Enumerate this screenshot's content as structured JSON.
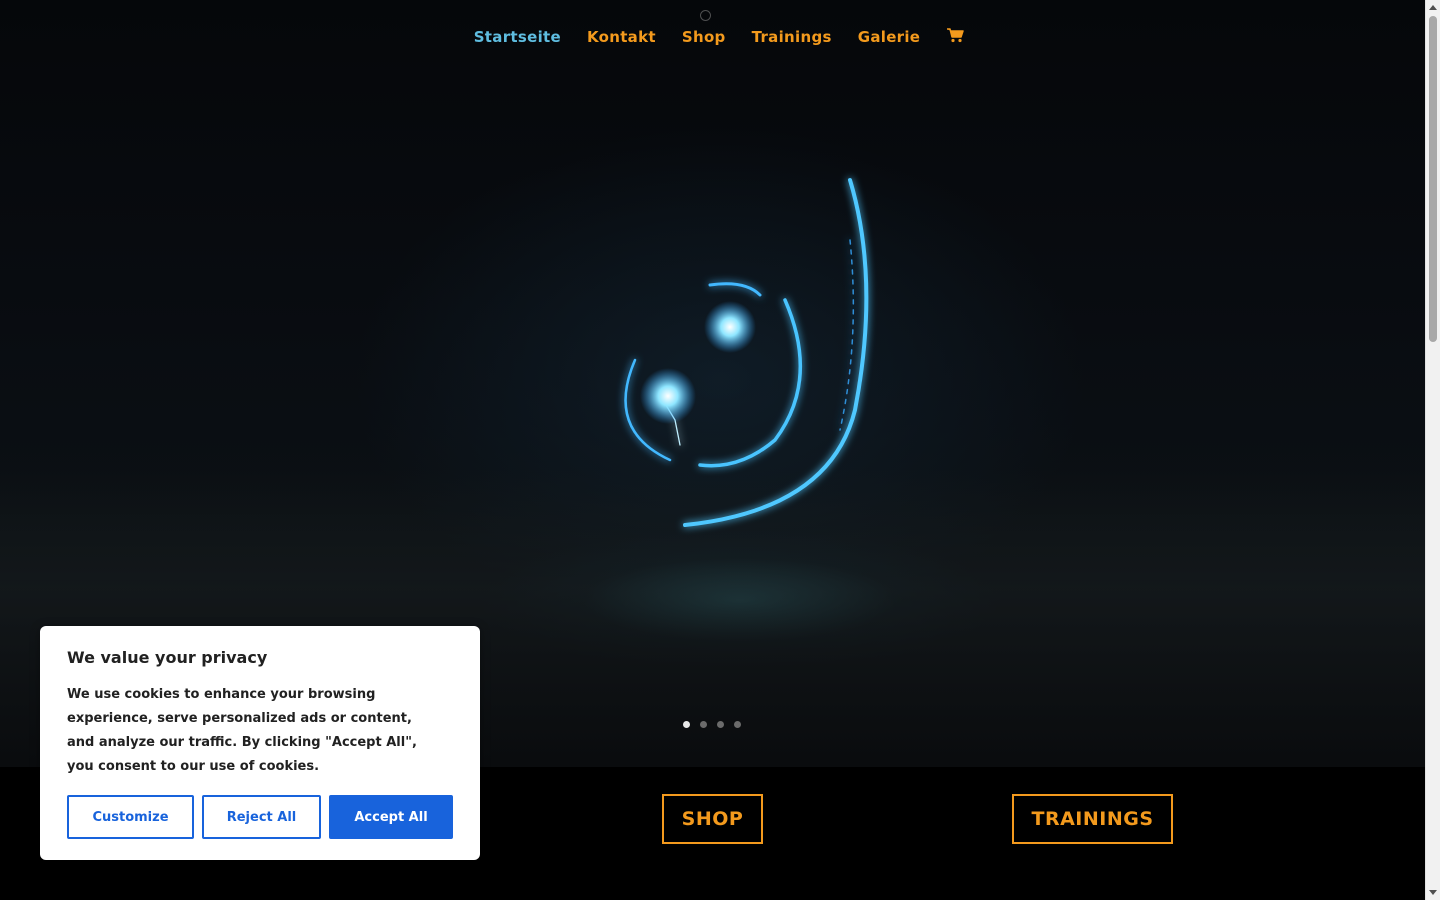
{
  "nav": {
    "items": [
      {
        "label": "Startseite",
        "active": true
      },
      {
        "label": "Kontakt",
        "active": false
      },
      {
        "label": "Shop",
        "active": false
      },
      {
        "label": "Trainings",
        "active": false
      },
      {
        "label": "Galerie",
        "active": false
      }
    ],
    "cart_icon": "cart-icon",
    "active_color": "#5fbde0",
    "link_color": "#f39a1d"
  },
  "slider": {
    "slide_count": 4,
    "active_slide": 1
  },
  "cta": {
    "shop_label": "SHOP",
    "trainings_label": "TRAININGS",
    "color": "#f39a1d"
  },
  "cookie_banner": {
    "title": "We value your privacy",
    "body": "We use cookies to enhance your browsing experience, serve personalized ads or content, and analyze our traffic. By clicking \"Accept All\", you consent to our use of cookies.",
    "customize_label": "Customize",
    "reject_label": "Reject All",
    "accept_label": "Accept All",
    "accent_color": "#1863dc"
  }
}
